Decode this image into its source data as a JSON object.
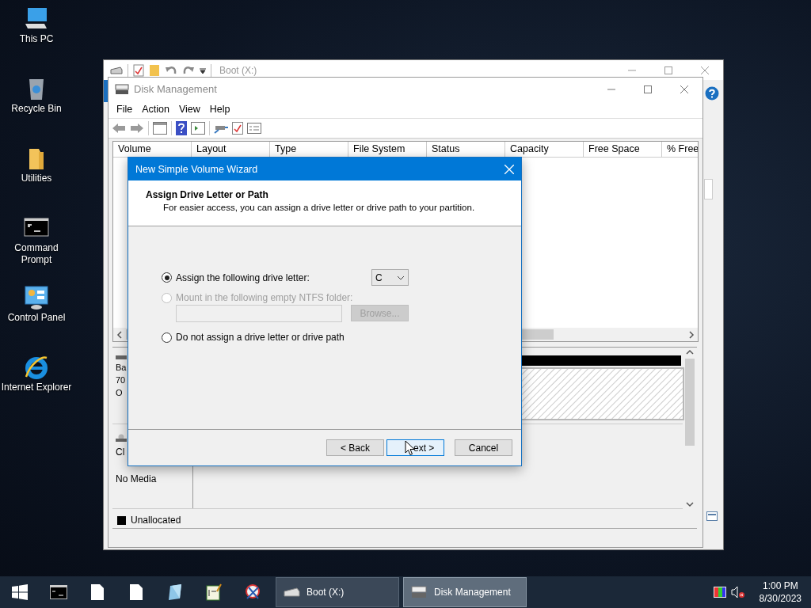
{
  "desktop_icons": [
    {
      "label": "This PC",
      "kind": "computer"
    },
    {
      "label": "Recycle Bin",
      "kind": "recycle"
    },
    {
      "label": "Utilities",
      "kind": "folder"
    },
    {
      "label": "Command Prompt",
      "kind": "console"
    },
    {
      "label": "Control Panel",
      "kind": "control"
    },
    {
      "label": "Internet Explorer",
      "kind": "browser"
    }
  ],
  "background_window": {
    "title": "Boot (X:)"
  },
  "disk_management": {
    "title": "Disk Management",
    "menu": [
      "File",
      "Action",
      "View",
      "Help"
    ],
    "columns": [
      "Volume",
      "Layout",
      "Type",
      "File System",
      "Status",
      "Capacity",
      "Free Space",
      "% Free"
    ],
    "disks": [
      {
        "kind": "disk",
        "lines": [
          "Ba",
          "70",
          "O"
        ]
      },
      {
        "kind": "cdrom",
        "lines": [
          "Cl",
          "No Media"
        ]
      }
    ],
    "legend": [
      "Unallocated"
    ]
  },
  "wizard": {
    "title": "New Simple Volume Wizard",
    "heading": "Assign Drive Letter or Path",
    "subheading": "For easier access, you can assign a drive letter or drive path to your partition.",
    "options": [
      {
        "label": "Assign the following drive letter:",
        "selected": true,
        "disabled": false
      },
      {
        "label": "Mount in the following empty NTFS folder:",
        "selected": false,
        "disabled": true
      },
      {
        "label": "Do not assign a drive letter or drive path",
        "selected": false,
        "disabled": false
      }
    ],
    "drive_letter": "C",
    "browse_button": {
      "label": "Browse...",
      "disabled": true
    },
    "buttons": [
      {
        "label": "< Back",
        "focused": false
      },
      {
        "label": "ext >",
        "focused": true
      },
      {
        "label": "Cancel",
        "focused": false
      }
    ]
  },
  "taskbar": {
    "windows": [
      {
        "label": "Boot (X:)",
        "selected": false,
        "kind": "drive"
      },
      {
        "label": "Disk Management",
        "selected": true,
        "kind": "diskmgmt"
      }
    ],
    "clock": {
      "time": "1:00 PM",
      "date": "8/30/2023"
    }
  }
}
